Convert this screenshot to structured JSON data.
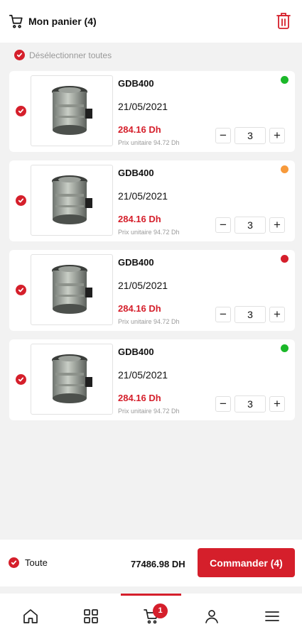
{
  "header": {
    "title": "Mon panier (4)"
  },
  "select_all": {
    "label": "Désélectionner toutes"
  },
  "items": [
    {
      "name": "GDB400",
      "date": "21/05/2021",
      "price": "284.16 Dh",
      "unit_price": "Prix unitaire 94.72 Dh",
      "quantity": "3",
      "status_color": "#1bb829"
    },
    {
      "name": "GDB400",
      "date": "21/05/2021",
      "price": "284.16 Dh",
      "unit_price": "Prix unitaire 94.72 Dh",
      "quantity": "3",
      "status_color": "#f79a3b"
    },
    {
      "name": "GDB400",
      "date": "21/05/2021",
      "price": "284.16 Dh",
      "unit_price": "Prix unitaire 94.72 Dh",
      "quantity": "3",
      "status_color": "#d51f2b"
    },
    {
      "name": "GDB400",
      "date": "21/05/2021",
      "price": "284.16 Dh",
      "unit_price": "Prix unitaire 94.72 Dh",
      "quantity": "3",
      "status_color": "#1bb829"
    }
  ],
  "stepper": {
    "minus": "−",
    "plus": "+"
  },
  "footer": {
    "all_label": "Toute",
    "total": "77486.98 DH",
    "order_label": "Commander (4)"
  },
  "nav": {
    "items": [
      {
        "icon": "home-icon"
      },
      {
        "icon": "grid-icon"
      },
      {
        "icon": "cart-icon",
        "badge": "1"
      },
      {
        "icon": "user-icon"
      },
      {
        "icon": "menu-icon"
      }
    ]
  },
  "colors": {
    "accent": "#d51f2b",
    "background": "#f2f2f2"
  }
}
